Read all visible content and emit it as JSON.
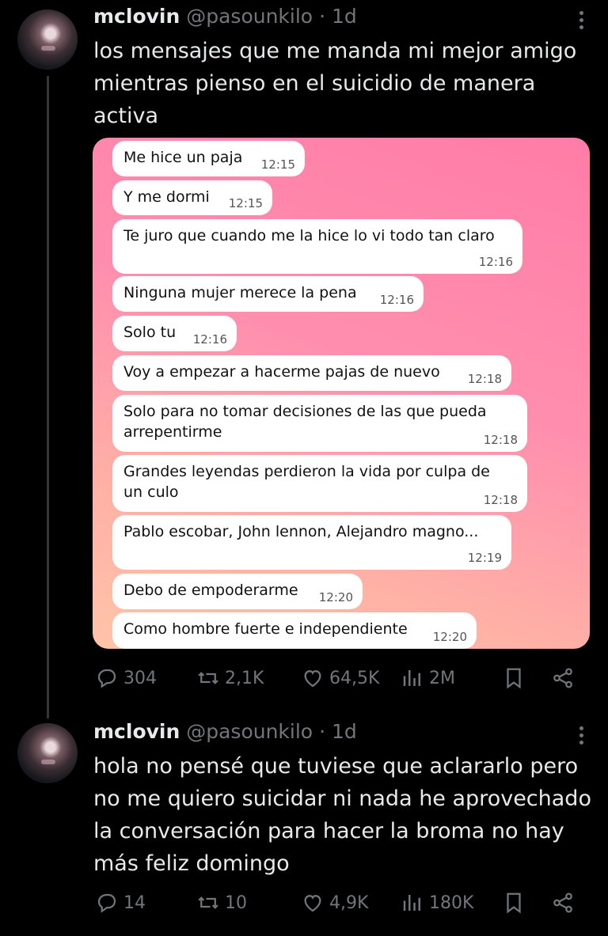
{
  "tweet1": {
    "name": "mclovin",
    "handle": "@pasounkilo",
    "dot": "·",
    "age": "1d",
    "text": "los mensajes que me manda mi mejor amigo mientras pienso en el suicidio de manera activa",
    "media": {
      "messages": [
        {
          "text": "Me hice un paja",
          "time": "12:15"
        },
        {
          "text": "Y me dormi",
          "time": "12:15"
        },
        {
          "text": "Te juro que cuando me la hice lo vi todo tan claro",
          "time": "12:16"
        },
        {
          "text": "Ninguna mujer merece la pena",
          "time": "12:16"
        },
        {
          "text": "Solo tu",
          "time": "12:16"
        },
        {
          "text": "Voy a empezar a hacerme pajas de nuevo",
          "time": "12:18"
        },
        {
          "text": "Solo para no tomar decisiones de las que pueda arrepentirme",
          "time": "12:18"
        },
        {
          "text": "Grandes leyendas perdieron la vida por culpa de un culo",
          "time": "12:18"
        },
        {
          "text": "Pablo escobar, John lennon, Alejandro magno...",
          "time": "12:19"
        },
        {
          "text": "Debo de empoderarme",
          "time": "12:20"
        },
        {
          "text": "Como hombre fuerte e independiente",
          "time": "12:20"
        }
      ]
    },
    "stats": {
      "replies": "304",
      "retweets": "2,1K",
      "likes": "64,5K",
      "views": "2M"
    }
  },
  "tweet2": {
    "name": "mclovin",
    "handle": "@pasounkilo",
    "dot": "·",
    "age": "1d",
    "text": "hola no pensé que tuviese que aclararlo pero no me quiero suicidar ni nada he aprovechado la conversación para hacer la broma no hay más feliz domingo",
    "stats": {
      "replies": "14",
      "retweets": "10",
      "likes": "4,9K",
      "views": "180K"
    }
  },
  "icons": [
    "reply-icon",
    "retweet-icon",
    "like-icon",
    "views-icon",
    "bookmark-icon",
    "share-icon",
    "more-icon"
  ],
  "colors": {
    "background": "#000000",
    "text": "#e7e9ea",
    "muted": "#71767b",
    "media_pink": "#ff7ca8",
    "media_peach": "#ffc4a8"
  }
}
